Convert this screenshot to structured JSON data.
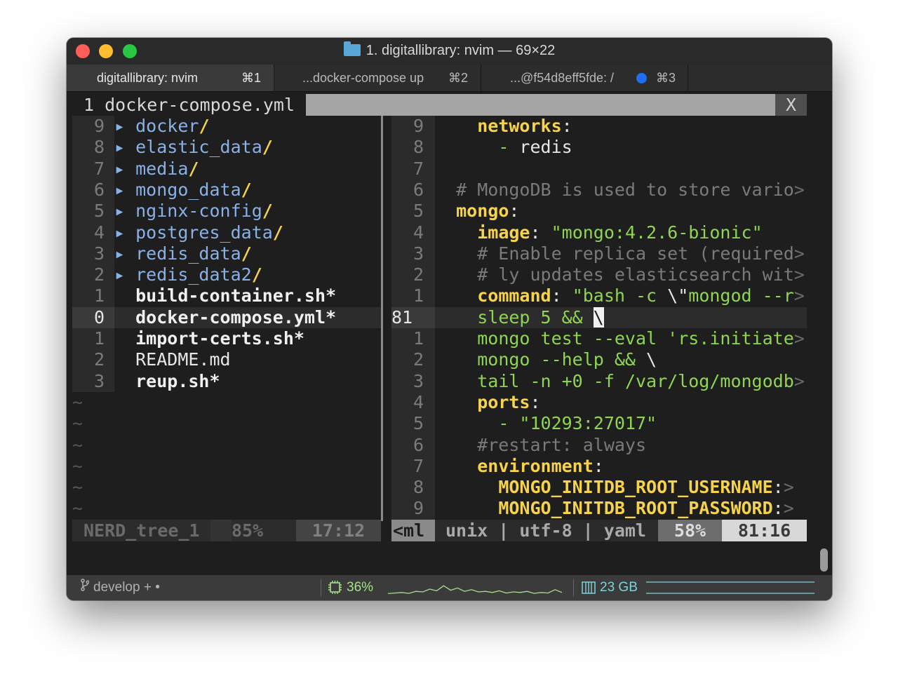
{
  "window": {
    "title": "1. digitallibrary: nvim — 69×22"
  },
  "tabs": [
    {
      "label": "digitallibrary: nvim",
      "shortcut": "⌘1",
      "active": true
    },
    {
      "label": "...docker-compose up",
      "shortcut": "⌘2",
      "active": false
    },
    {
      "label": "...@f54d8eff5fde: /",
      "shortcut": "⌘3",
      "active": false
    }
  ],
  "vim_tabline": {
    "current_tab": "1 docker-compose.yml",
    "close_label": "X"
  },
  "tree": {
    "rows": [
      {
        "num": "9",
        "arrow": "▸",
        "name": "docker",
        "suffix": "/",
        "kind": "dir"
      },
      {
        "num": "8",
        "arrow": "▸",
        "name": "elastic_data",
        "suffix": "/",
        "kind": "dir"
      },
      {
        "num": "7",
        "arrow": "▸",
        "name": "media",
        "suffix": "/",
        "kind": "dir"
      },
      {
        "num": "6",
        "arrow": "▸",
        "name": "mongo_data",
        "suffix": "/",
        "kind": "dir"
      },
      {
        "num": "5",
        "arrow": "▸",
        "name": "nginx-config",
        "suffix": "/",
        "kind": "dir"
      },
      {
        "num": "4",
        "arrow": "▸",
        "name": "postgres_data",
        "suffix": "/",
        "kind": "dir"
      },
      {
        "num": "3",
        "arrow": "▸",
        "name": "redis_data",
        "suffix": "/",
        "kind": "dir"
      },
      {
        "num": "2",
        "arrow": "▸",
        "name": "redis_data2",
        "suffix": "/",
        "kind": "dir"
      },
      {
        "num": "1",
        "arrow": "",
        "name": "build-container.sh*",
        "suffix": "",
        "kind": "exe"
      },
      {
        "num": "0",
        "arrow": "",
        "name": "docker-compose.yml*",
        "suffix": "",
        "kind": "exe",
        "current": true
      },
      {
        "num": "1",
        "arrow": "",
        "name": "import-certs.sh*",
        "suffix": "",
        "kind": "exe"
      },
      {
        "num": "2",
        "arrow": "",
        "name": "README.md",
        "suffix": "",
        "kind": "plain"
      },
      {
        "num": "3",
        "arrow": "",
        "name": "reup.sh*",
        "suffix": "",
        "kind": "exe"
      }
    ],
    "tilde": "~",
    "tilde_count": 6
  },
  "editor": {
    "rows": [
      {
        "num": "9",
        "parts": [
          {
            "t": "    ",
            "c": "plain"
          },
          {
            "t": "networks",
            "c": "key"
          },
          {
            "t": ":",
            "c": "plain"
          }
        ]
      },
      {
        "num": "8",
        "parts": [
          {
            "t": "      ",
            "c": "plain"
          },
          {
            "t": "- ",
            "c": "val"
          },
          {
            "t": "redis",
            "c": "plain"
          }
        ]
      },
      {
        "num": "7",
        "parts": []
      },
      {
        "num": "6",
        "parts": [
          {
            "t": "  # MongoDB is used to store vario",
            "c": "cmt"
          },
          {
            "t": ">",
            "c": "trunc"
          }
        ]
      },
      {
        "num": "5",
        "parts": [
          {
            "t": "  ",
            "c": "plain"
          },
          {
            "t": "mongo",
            "c": "key"
          },
          {
            "t": ":",
            "c": "plain"
          }
        ]
      },
      {
        "num": "4",
        "parts": [
          {
            "t": "    ",
            "c": "plain"
          },
          {
            "t": "image",
            "c": "key"
          },
          {
            "t": ": ",
            "c": "plain"
          },
          {
            "t": "\"mongo:4.2.6-bionic\"",
            "c": "val"
          }
        ]
      },
      {
        "num": "3",
        "parts": [
          {
            "t": "    # Enable replica set (required",
            "c": "cmt"
          },
          {
            "t": ">",
            "c": "trunc"
          }
        ]
      },
      {
        "num": "2",
        "parts": [
          {
            "t": "    # ly updates elasticsearch wit",
            "c": "cmt"
          },
          {
            "t": ">",
            "c": "trunc"
          }
        ]
      },
      {
        "num": "1",
        "parts": [
          {
            "t": "    ",
            "c": "plain"
          },
          {
            "t": "command",
            "c": "key"
          },
          {
            "t": ": ",
            "c": "plain"
          },
          {
            "t": "\"bash -c ",
            "c": "val"
          },
          {
            "t": "\\\"",
            "c": "plain"
          },
          {
            "t": "mongod --r",
            "c": "val"
          },
          {
            "t": ">",
            "c": "trunc"
          }
        ]
      },
      {
        "num": "81",
        "current": true,
        "parts": [
          {
            "t": "    ",
            "c": "plain"
          },
          {
            "t": "sleep 5 && ",
            "c": "val"
          },
          {
            "t": "\\",
            "c": "cursor"
          }
        ]
      },
      {
        "num": "1",
        "parts": [
          {
            "t": "    ",
            "c": "plain"
          },
          {
            "t": "mongo test --eval 'rs.initiate",
            "c": "val"
          },
          {
            "t": ">",
            "c": "trunc"
          }
        ]
      },
      {
        "num": "2",
        "parts": [
          {
            "t": "    ",
            "c": "plain"
          },
          {
            "t": "mongo --help && ",
            "c": "val"
          },
          {
            "t": "\\",
            "c": "plain"
          }
        ]
      },
      {
        "num": "3",
        "parts": [
          {
            "t": "    ",
            "c": "plain"
          },
          {
            "t": "tail -n +0 -f /var/log/mongodb",
            "c": "val"
          },
          {
            "t": ">",
            "c": "trunc"
          }
        ]
      },
      {
        "num": "4",
        "parts": [
          {
            "t": "    ",
            "c": "plain"
          },
          {
            "t": "ports",
            "c": "key"
          },
          {
            "t": ":",
            "c": "plain"
          }
        ]
      },
      {
        "num": "5",
        "parts": [
          {
            "t": "      ",
            "c": "plain"
          },
          {
            "t": "- \"10293:27017\"",
            "c": "val"
          }
        ]
      },
      {
        "num": "6",
        "parts": [
          {
            "t": "    #restart: always",
            "c": "cmt"
          }
        ]
      },
      {
        "num": "7",
        "parts": [
          {
            "t": "    ",
            "c": "plain"
          },
          {
            "t": "environment",
            "c": "key"
          },
          {
            "t": ":",
            "c": "plain"
          }
        ]
      },
      {
        "num": "8",
        "parts": [
          {
            "t": "      ",
            "c": "plain"
          },
          {
            "t": "MONGO_INITDB_ROOT_USERNAME",
            "c": "key"
          },
          {
            "t": ":",
            "c": "plain"
          },
          {
            "t": ">",
            "c": "trunc"
          }
        ]
      },
      {
        "num": "9",
        "parts": [
          {
            "t": "      ",
            "c": "plain"
          },
          {
            "t": "MONGO_INITDB_ROOT_PASSWORD",
            "c": "key"
          },
          {
            "t": ":",
            "c": "plain"
          },
          {
            "t": ">",
            "c": "trunc"
          }
        ]
      }
    ]
  },
  "status_left": {
    "name": "NERD_tree_1",
    "percent": "85%",
    "position": "17:12"
  },
  "status_right": {
    "filename": "<ml",
    "info": "unix | utf-8 | yaml",
    "percent": "58%",
    "position": "81:16"
  },
  "bottom_bar": {
    "branch": "develop + •",
    "cpu": "36%",
    "mem": "23 GB",
    "cpu_color": "#a6e08a",
    "mem_color": "#7fd3d8",
    "cpu_history": [
      0.1,
      0.15,
      0.2,
      0.12,
      0.3,
      0.25,
      0.5,
      0.35,
      0.8,
      0.4,
      0.6,
      0.3,
      0.45,
      0.25,
      0.3,
      0.2,
      0.35,
      0.15,
      0.25,
      0.2,
      0.3,
      0.12,
      0.2,
      0.15,
      0.45,
      0.2
    ]
  }
}
